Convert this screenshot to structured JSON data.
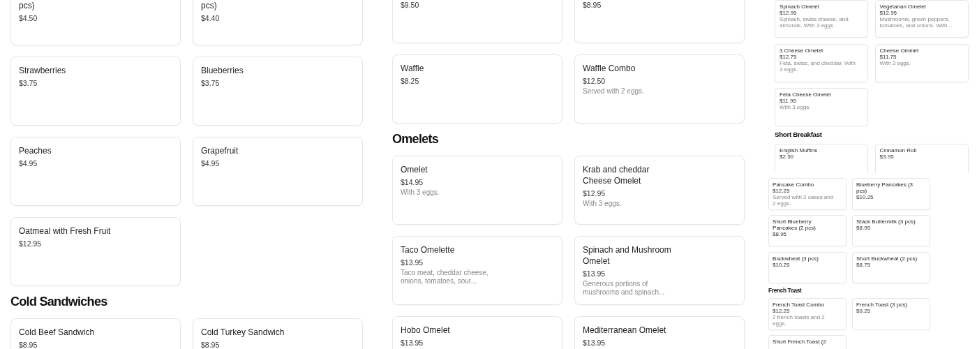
{
  "panels": [
    {
      "sections": [
        {
          "items": [
            {
              "name": "pcs)",
              "price": "$4.50"
            },
            {
              "name": "pcs)",
              "price": "$4.40"
            },
            {
              "name": "Strawberries",
              "price": "$3.75"
            },
            {
              "name": "Blueberries",
              "price": "$3.75"
            },
            {
              "name": "Peaches",
              "price": "$4.95"
            },
            {
              "name": "Grapefruit",
              "price": "$4.95"
            },
            {
              "name": "Oatmeal with Fresh Fruit",
              "price": "$12.95"
            }
          ]
        },
        {
          "heading": "Cold Sandwiches",
          "items": [
            {
              "name": "Cold Beef Sandwich",
              "price": "$8.95"
            },
            {
              "name": "Cold Turkey Sandwich",
              "price": "$8.95"
            }
          ]
        }
      ]
    },
    {
      "sections": [
        {
          "items": [
            {
              "price": "$9.50"
            },
            {
              "price": "$8.95"
            },
            {
              "name": "Waffle",
              "price": "$8.25"
            },
            {
              "name": "Waffle Combo",
              "price": "$12.50",
              "description": "Served with 2 eggs."
            }
          ]
        },
        {
          "heading": "Omelets",
          "items": [
            {
              "name": "Omelet",
              "price": "$14.95",
              "description": "With 3 eggs."
            },
            {
              "name": "Krab and cheddar Cheese Omelet",
              "price": "$12.95",
              "description": "With 3 eggs."
            },
            {
              "name": "Taco Omelette",
              "price": "$13.95",
              "description": "Taco meat, cheddar cheese, onions, tomatoes, sour..."
            },
            {
              "name": "Spinach and Mushroom Omelet",
              "price": "$13.95",
              "description": "Generous portions of mushrooms and spinach..."
            },
            {
              "name": "Hobo Omelet",
              "price": "$13.95"
            },
            {
              "name": "Mediterranean Omelet",
              "price": "$13.95"
            }
          ]
        }
      ]
    },
    {
      "sections": [
        {
          "items": [
            {
              "name": "Spinach Omelet",
              "price": "$12.95",
              "description": "Spinach, swiss cheese, and almonds. With 3 eggs."
            },
            {
              "name": "Vegetarian Omelet",
              "price": "$12.95",
              "description": "Mushrooms, green peppers, tomatoes, and onions. With..."
            },
            {
              "name": "3 Cheese Omelet",
              "price": "$12.75",
              "description": "Feta, swiss, and cheddar. With 3 eggs."
            },
            {
              "name": "Cheese Omelet",
              "price": "$11.75",
              "description": "With 3 eggs."
            },
            {
              "name": "Feta Cheese  Omelet",
              "price": "$11.95",
              "description": "With 3 eggs."
            }
          ]
        },
        {
          "heading": "Short Breakfast",
          "items": [
            {
              "name": "English Muffins",
              "price": "$2.50"
            },
            {
              "name": "Cinnamon Roll",
              "price": "$3.95"
            }
          ]
        }
      ]
    },
    {
      "sections": [
        {
          "items": [
            {
              "name": "Pancake Combo",
              "price": "$12.25",
              "description": "Served with 2 cakes and 2 eggs."
            },
            {
              "name": "Blueberry Pancakes (3 pcs)",
              "price": "$10.25"
            },
            {
              "name": "Short Blueberry Pancakes (2 pcs)",
              "price": "$8.95"
            },
            {
              "name": "Stack Buttermilk (3 pcs)",
              "price": "$8.95"
            },
            {
              "name": "Buckwheat (3 pcs)",
              "price": "$10.25"
            },
            {
              "name": "Short Buckwheat (2 pcs)",
              "price": "$8.75"
            }
          ]
        },
        {
          "heading": "French Toast",
          "items": [
            {
              "name": "French Toast Combo",
              "price": "$12.25",
              "description": "2 french toasts and 2 eggs."
            },
            {
              "name": "French Toast (3 pcs)",
              "price": "$9.25"
            },
            {
              "name": "Short French Toast (2"
            }
          ]
        }
      ]
    }
  ]
}
